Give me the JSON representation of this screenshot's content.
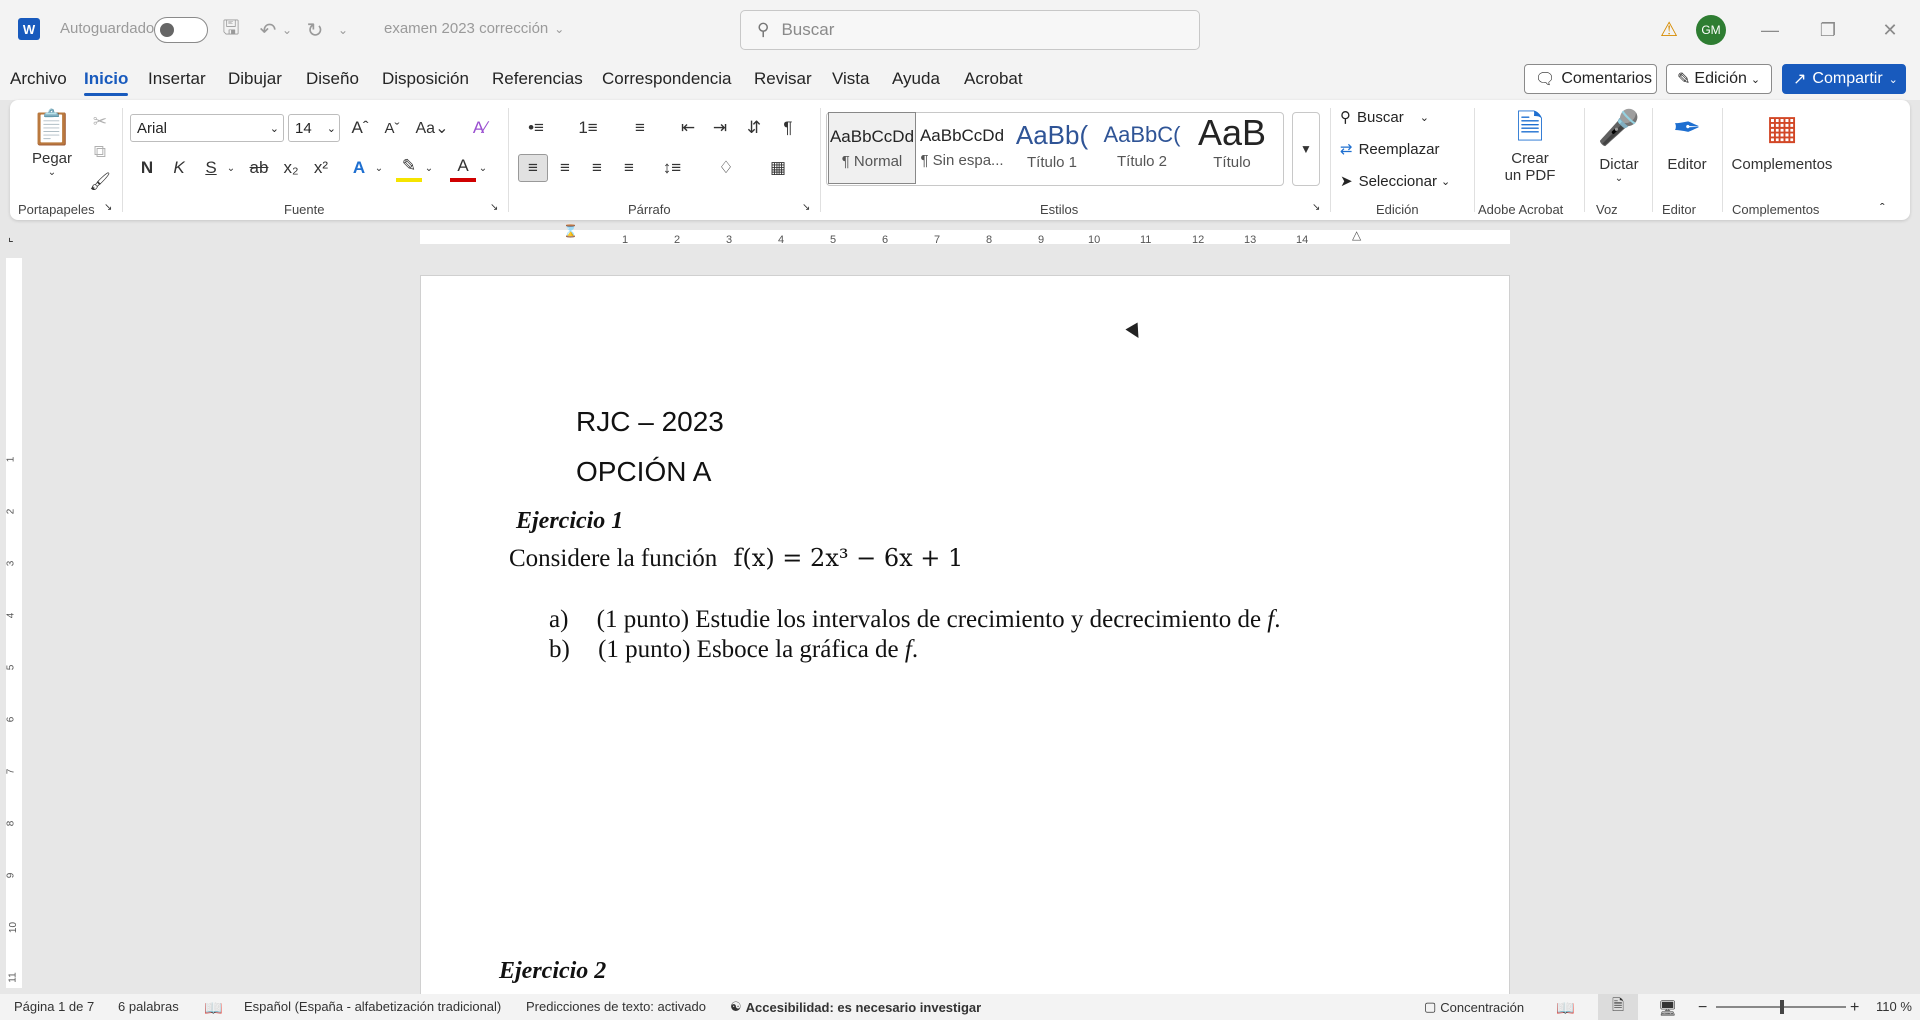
{
  "titlebar": {
    "autosave_label": "Autoguardado",
    "doc_title": "examen 2023 corrección",
    "search_placeholder": "Buscar",
    "avatar_initials": "GM"
  },
  "menu": {
    "tabs": [
      "Archivo",
      "Inicio",
      "Insertar",
      "Dibujar",
      "Diseño",
      "Disposición",
      "Referencias",
      "Correspondencia",
      "Revisar",
      "Vista",
      "Ayuda",
      "Acrobat"
    ],
    "active_tab": "Inicio",
    "comments_label": "Comentarios",
    "edit_label": "Edición",
    "share_label": "Compartir"
  },
  "ribbon": {
    "clipboard": {
      "paste_label": "Pegar",
      "group_label": "Portapapeles"
    },
    "font": {
      "name": "Arial",
      "size": "14",
      "group_label": "Fuente"
    },
    "paragraph": {
      "group_label": "Párrafo"
    },
    "styles": {
      "group_label": "Estilos",
      "items": [
        {
          "sample": "AaBbCcDd",
          "name": "¶ Normal"
        },
        {
          "sample": "AaBbCcDd",
          "name": "¶ Sin espa..."
        },
        {
          "sample": "AaBb(",
          "name": "Título 1"
        },
        {
          "sample": "AaBbC(",
          "name": "Título 2"
        },
        {
          "sample": "AaB",
          "name": "Título"
        }
      ]
    },
    "editing": {
      "find": "Buscar",
      "replace": "Reemplazar",
      "select": "Seleccionar",
      "group_label": "Edición"
    },
    "acrobat": {
      "line1": "Crear",
      "line2": "un PDF",
      "group_label": "Adobe Acrobat"
    },
    "voice": {
      "label": "Dictar",
      "group_label": "Voz"
    },
    "editor": {
      "label": "Editor",
      "group_label": "Editor"
    },
    "addins": {
      "label": "Complementos",
      "group_label": "Complementos"
    }
  },
  "document": {
    "line1": "RJC – 2023",
    "line2": "OPCIÓN A",
    "exercise1": "Ejercicio 1",
    "consider": "Considere la función",
    "formula": "f(x) = 2x³ − 6x + 1",
    "item_a_marker": "a)",
    "item_a_text": "(1 punto) Estudie los intervalos de crecimiento y decrecimiento de ",
    "item_b_marker": "b)",
    "item_b_text": "(1 punto) Esboce la gráfica de ",
    "func_symbol": "f",
    "period": ".",
    "exercise2": "Ejercicio 2"
  },
  "statusbar": {
    "page": "Página 1 de 7",
    "words": "6 palabras",
    "language": "Español (España - alfabetización tradicional)",
    "predictions": "Predicciones de texto: activado",
    "accessibility": "Accesibilidad: es necesario investigar",
    "focus": "Concentración",
    "zoom": "110 %"
  },
  "ruler": {
    "h_numbers": [
      "1",
      "2",
      "3",
      "4",
      "5",
      "6",
      "7",
      "8",
      "9",
      "10",
      "11",
      "12",
      "13",
      "14"
    ],
    "v_numbers": [
      "1",
      "2",
      "3",
      "4",
      "5",
      "6",
      "7",
      "8",
      "9",
      "10",
      "11"
    ]
  }
}
